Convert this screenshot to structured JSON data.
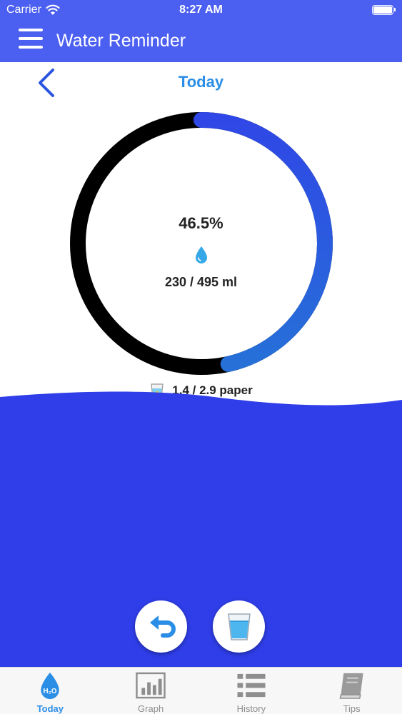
{
  "status_bar": {
    "carrier": "Carrier",
    "time": "8:27 AM"
  },
  "header": {
    "title": "Water Reminder"
  },
  "day": {
    "title": "Today"
  },
  "progress": {
    "percent_text": "46.5%",
    "fraction": 0.465,
    "amount_text": "230 / 495 ml",
    "cups_text": "1.4 / 2.9 paper"
  },
  "colors": {
    "header_bg": "#4b5ff0",
    "water": "#2f3ee8",
    "ring_progress": "#2f5be0",
    "ring_track": "#000000",
    "accent": "#2b8ee6"
  },
  "icons": {
    "menu": "hamburger-icon",
    "back": "chevron-left-icon",
    "drop": "water-drop-icon",
    "cup": "paper-cup-icon",
    "undo": "undo-icon",
    "add": "water-glass-icon"
  },
  "tabs": [
    {
      "label": "Today",
      "icon": "h2o-drop-icon",
      "active": true
    },
    {
      "label": "Graph",
      "icon": "bar-graph-icon",
      "active": false
    },
    {
      "label": "History",
      "icon": "list-icon",
      "active": false
    },
    {
      "label": "Tips",
      "icon": "book-icon",
      "active": false
    }
  ]
}
